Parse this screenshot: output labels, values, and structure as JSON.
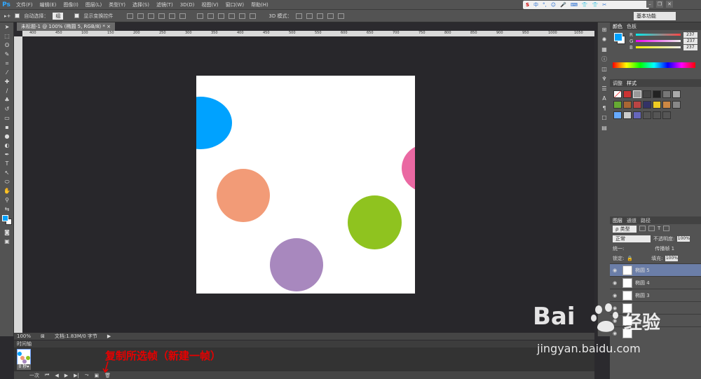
{
  "app": {
    "logo": "Ps"
  },
  "menu": [
    "文件(F)",
    "编辑(E)",
    "图像(I)",
    "图层(L)",
    "类型(Y)",
    "选择(S)",
    "滤镜(T)",
    "3D(D)",
    "视图(V)",
    "窗口(W)",
    "帮助(H)"
  ],
  "options": {
    "auto_select_label": "自动选择：",
    "auto_select_value": "组",
    "show_transform_label": "显示变换控件",
    "mode_3d_label": "3D 模式："
  },
  "ime": {
    "brand": "S",
    "items": [
      "中",
      "°,",
      "☺",
      "🎤",
      "⌨",
      "👕",
      "👕",
      "✂"
    ]
  },
  "workspace": "基本功能",
  "document": {
    "tab_title": "未标题-1 @ 100% (椭圆 5, RGB/8) *",
    "zoom": "100%",
    "doc_info": "文档:1.83M/0 字节"
  },
  "ruler_ticks": [
    "400",
    "450",
    "100",
    "150",
    "200",
    "250",
    "300",
    "350",
    "400",
    "450",
    "500",
    "550",
    "600",
    "650",
    "700",
    "750",
    "800",
    "850",
    "900",
    "950",
    "1000",
    "1050"
  ],
  "circles": [
    {
      "name": "blue-circle",
      "color": "#00a2ff"
    },
    {
      "name": "salmon-circle",
      "color": "#f29b77"
    },
    {
      "name": "pink-circle",
      "color": "#ea68a2"
    },
    {
      "name": "green-circle",
      "color": "#8fc31f"
    },
    {
      "name": "purple-circle",
      "color": "#a888be"
    }
  ],
  "color_panel": {
    "tabs": [
      "颜色",
      "色板"
    ],
    "r": "237",
    "g": "237",
    "b": "237",
    "r_label": "R",
    "g_label": "G",
    "b_label": "B"
  },
  "styles_panel": {
    "tabs": [
      "调整",
      "样式"
    ]
  },
  "layers_panel": {
    "tabs": [
      "图层",
      "通道",
      "路径"
    ],
    "filter_kind": "ρ 类型",
    "blend_mode": "正常",
    "opacity_label": "不透明度:",
    "opacity": "100%",
    "lock_label": "锁定:",
    "fill_label": "填充:",
    "fill": "100%",
    "unify_label": "统一:",
    "propagate_label": "传播帧 1",
    "layers": [
      {
        "name": "椭圆 5",
        "selected": true
      },
      {
        "name": "椭圆 4",
        "selected": false
      },
      {
        "name": "椭圆 3",
        "selected": false
      },
      {
        "name": "",
        "selected": false
      },
      {
        "name": "",
        "selected": false
      },
      {
        "name": "",
        "selected": false
      }
    ]
  },
  "timeline": {
    "tab": "时间轴",
    "frame_time": "0 秒▾",
    "loop": "一次"
  },
  "annotation": "复制所选帧（新建一帧）",
  "watermark": {
    "brand_left": "Bai",
    "brand_right": "经验",
    "url": "jingyan.baidu.com"
  }
}
